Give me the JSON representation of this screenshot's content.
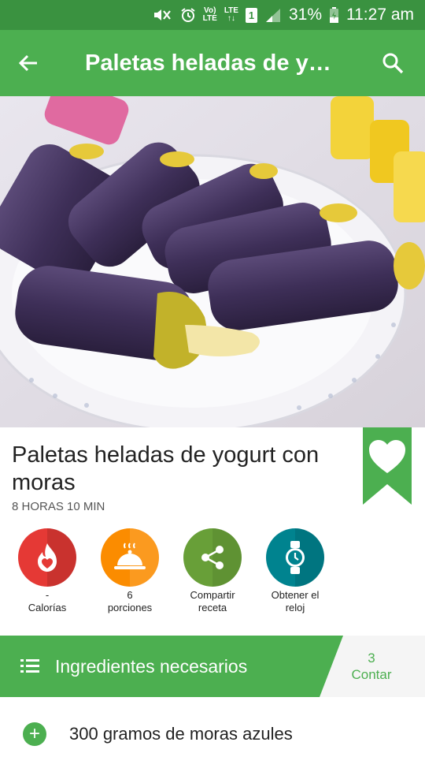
{
  "status_bar": {
    "mute_icon": "vibrate-mute-icon",
    "alarm_icon": "alarm-icon",
    "volte_top": "Vo)",
    "volte_bottom": "LTE",
    "lte_top": "LTE",
    "lte_bottom": "↑↓",
    "sim_label": "1",
    "signal_icon": "signal-icon",
    "battery_percent": "31%",
    "battery_icon": "battery-charging-icon",
    "time": "11:27 am"
  },
  "toolbar": {
    "back_icon": "arrow-back-icon",
    "title": "Paletas heladas de yogurt con moras",
    "search_icon": "search-icon",
    "color": "#4caf50"
  },
  "recipe": {
    "title": "Paletas heladas de yogurt con moras",
    "time": "8 HORAS 10 MIN",
    "bookmark_icon": "heart-bookmark-icon"
  },
  "actions": [
    {
      "icon": "calories-flame-icon",
      "value": "-",
      "label": "Calorías",
      "color": "#e53935"
    },
    {
      "icon": "serving-dish-icon",
      "value": "6",
      "label": "porciones",
      "color": "#fb8c00"
    },
    {
      "icon": "share-icon",
      "value": "Compartir",
      "label": "receta",
      "color": "#689f38"
    },
    {
      "icon": "watch-icon",
      "value": "Obtener el",
      "label": "reloj",
      "color": "#00838f"
    }
  ],
  "ingredients": {
    "header_label": "Ingredientes necesarios",
    "list_icon": "list-icon",
    "count_value": "3",
    "count_label": "Contar",
    "items": [
      {
        "add_icon": "add-circle-icon",
        "text": "300 gramos de moras azules"
      }
    ]
  }
}
